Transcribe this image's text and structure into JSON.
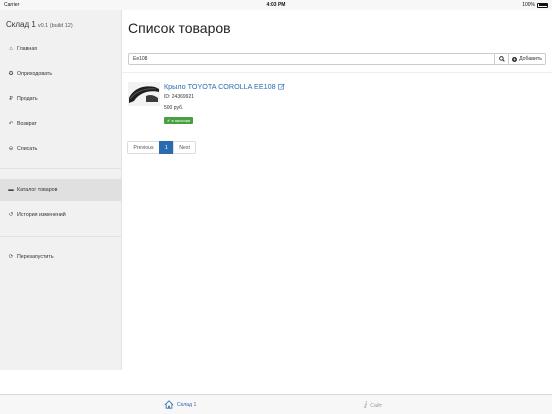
{
  "statusbar": {
    "carrier": "Carrier",
    "time": "4:03 PM",
    "battery": "100%"
  },
  "sidebar": {
    "title": "Склад 1",
    "version": "v0.1 (build 12)",
    "items": [
      {
        "label": "Главная",
        "icon": "home-icon",
        "glyph": "⌂"
      },
      {
        "label": "Оприходовать",
        "icon": "gear-icon",
        "glyph": "✪"
      },
      {
        "label": "Продать",
        "icon": "ruble-icon",
        "glyph": "₽"
      },
      {
        "label": "Возврат",
        "icon": "undo-icon",
        "glyph": "↶"
      },
      {
        "label": "Списать",
        "icon": "minus-circle-icon",
        "glyph": "⊖"
      },
      {
        "label": "Каталог товаров",
        "icon": "book-icon",
        "glyph": "▬"
      },
      {
        "label": "История изменений",
        "icon": "history-icon",
        "glyph": "↺"
      },
      {
        "label": "Перезапустить",
        "icon": "refresh-icon",
        "glyph": "⟳"
      }
    ]
  },
  "main": {
    "title": "Список товаров",
    "search": {
      "value": "Ee108",
      "placeholder": ""
    },
    "add_label": "Добавить",
    "product": {
      "name": "Крыло TOYOTA COROLLA EE108",
      "id": "ID: 24369921",
      "price": "500 руб.",
      "badge": "✔ в наличии"
    },
    "pagination": {
      "previous": "Previous",
      "page": "1",
      "next": "Next"
    }
  },
  "tabbar": {
    "tab1": "Склад 1",
    "tab2": "Сайт"
  },
  "colors": {
    "accent": "#2b6cb0",
    "badge": "#49a043"
  }
}
